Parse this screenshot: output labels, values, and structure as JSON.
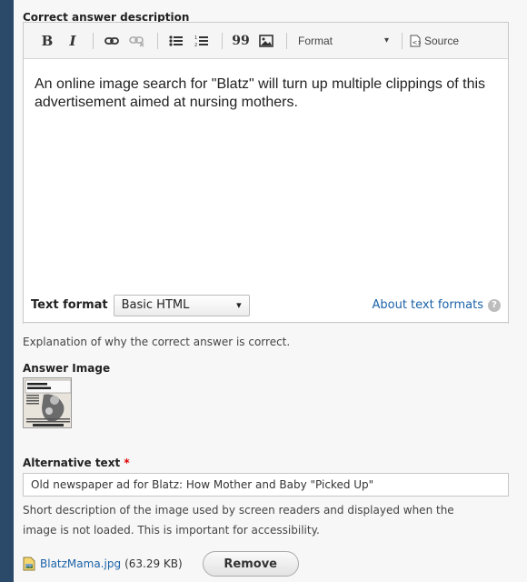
{
  "description_field": {
    "label": "Correct answer description",
    "toolbar": {
      "bold": "B",
      "italic": "I",
      "blockquote": "99",
      "format_label": "Format",
      "format_arrow": "▾",
      "source_label": "Source"
    },
    "content": "An online image search for \"Blatz\" will turn up multiple clippings of this advertisement aimed at nursing mothers.",
    "text_format": {
      "label": "Text format",
      "selected": "Basic HTML",
      "arrow": "▾",
      "about_link": "About text formats",
      "help_glyph": "?"
    },
    "help_text": "Explanation of why the correct answer is correct."
  },
  "answer_image": {
    "label": "Answer Image",
    "alt_label": "Alternative text",
    "required_marker": "*",
    "alt_value": "Old newspaper ad for Blatz: How Mother and Baby \"Picked Up\"",
    "alt_help_line1": "Short description of the image used by screen readers and displayed when the",
    "alt_help_line2": "image is not loaded. This is important for accessibility.",
    "file_name": "BlatzMama.jpg",
    "file_size": "(63.29 KB)",
    "remove_label": "Remove"
  },
  "colors": {
    "link": "#1a62a8",
    "required": "#dd0000",
    "frame": "#2b4a6a"
  }
}
